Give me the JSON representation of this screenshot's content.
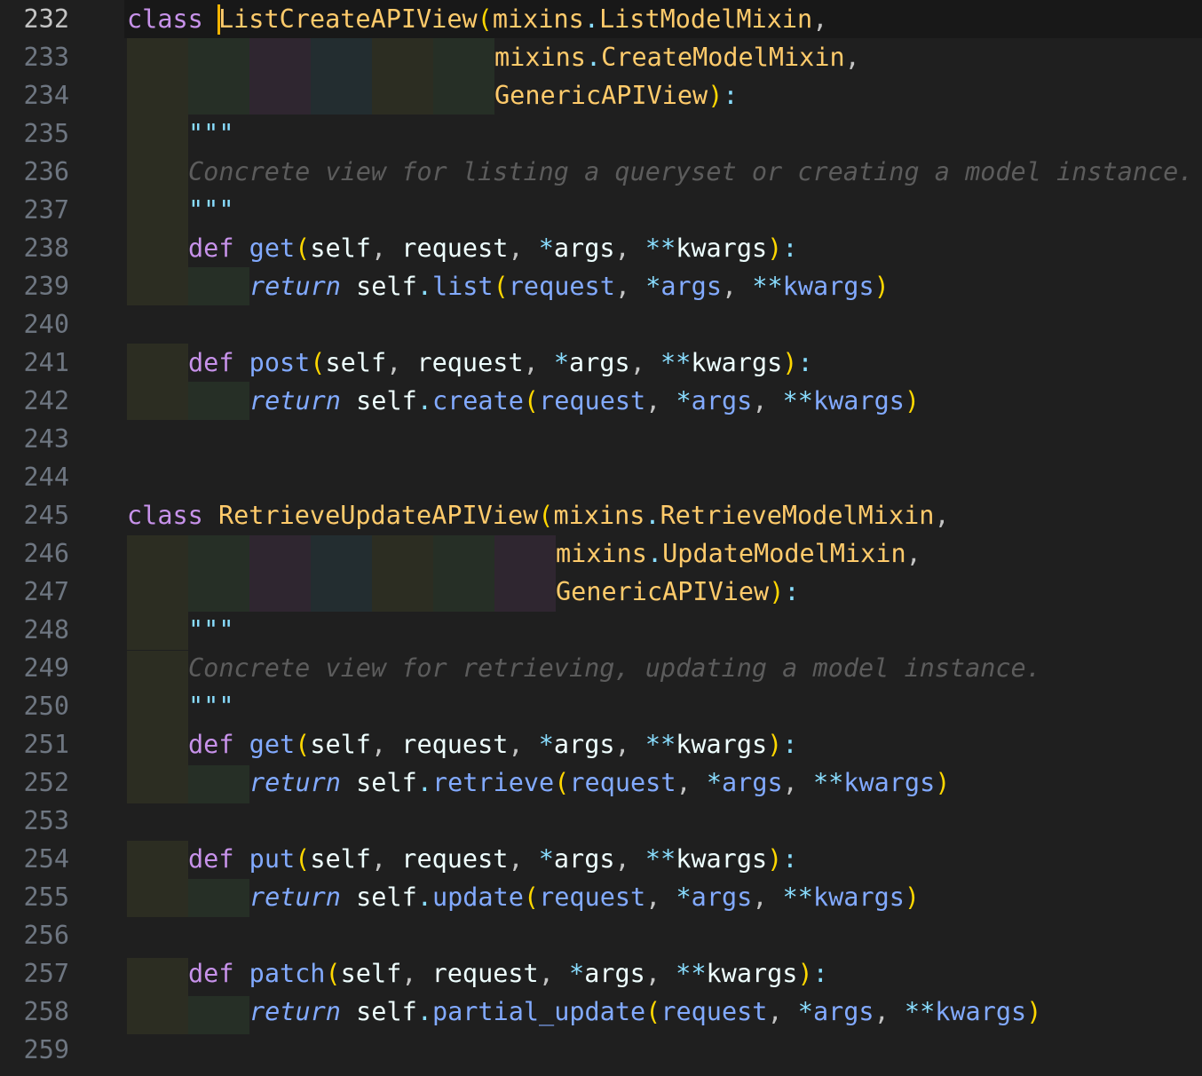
{
  "editor": {
    "current_line": 232,
    "cursor_line": 232
  },
  "line_numbers": [
    "232",
    "233",
    "234",
    "235",
    "236",
    "237",
    "238",
    "239",
    "240",
    "241",
    "242",
    "243",
    "244",
    "245",
    "246",
    "247",
    "248",
    "249",
    "250",
    "251",
    "252",
    "253",
    "254",
    "255",
    "256",
    "257",
    "258",
    "259"
  ],
  "code": {
    "l232": {
      "kw": "class",
      "name": "ListCreateAPIView",
      "open": "(",
      "mod": "mixins",
      "dot": ".",
      "base": "ListModelMixin",
      "comma": ","
    },
    "l233": {
      "mod": "mixins",
      "dot": ".",
      "base": "CreateModelMixin",
      "comma": ","
    },
    "l234": {
      "base": "GenericAPIView",
      "close": ")",
      "colon": ":"
    },
    "l235": {
      "quote": "\"\"\""
    },
    "l236": {
      "doc": "Concrete view for listing a queryset or creating a model instance."
    },
    "l237": {
      "quote": "\"\"\""
    },
    "l238": {
      "kw": "def",
      "fn": "get",
      "self": "self",
      "request": "request",
      "star": "*",
      "args": "args",
      "dstar": "**",
      "kwargs": "kwargs"
    },
    "l239": {
      "ret": "return",
      "self": "self",
      "call": "list",
      "request": "request",
      "star": "*",
      "args": "args",
      "dstar": "**",
      "kwargs": "kwargs"
    },
    "l241": {
      "kw": "def",
      "fn": "post",
      "self": "self",
      "request": "request",
      "star": "*",
      "args": "args",
      "dstar": "**",
      "kwargs": "kwargs"
    },
    "l242": {
      "ret": "return",
      "self": "self",
      "call": "create",
      "request": "request",
      "star": "*",
      "args": "args",
      "dstar": "**",
      "kwargs": "kwargs"
    },
    "l245": {
      "kw": "class",
      "name": "RetrieveUpdateAPIView",
      "open": "(",
      "mod": "mixins",
      "dot": ".",
      "base": "RetrieveModelMixin",
      "comma": ","
    },
    "l246": {
      "mod": "mixins",
      "dot": ".",
      "base": "UpdateModelMixin",
      "comma": ","
    },
    "l247": {
      "base": "GenericAPIView",
      "close": ")",
      "colon": ":"
    },
    "l248": {
      "quote": "\"\"\""
    },
    "l249": {
      "doc": "Concrete view for retrieving, updating a model instance."
    },
    "l250": {
      "quote": "\"\"\""
    },
    "l251": {
      "kw": "def",
      "fn": "get",
      "self": "self",
      "request": "request",
      "star": "*",
      "args": "args",
      "dstar": "**",
      "kwargs": "kwargs"
    },
    "l252": {
      "ret": "return",
      "self": "self",
      "call": "retrieve",
      "request": "request",
      "star": "*",
      "args": "args",
      "dstar": "**",
      "kwargs": "kwargs"
    },
    "l254": {
      "kw": "def",
      "fn": "put",
      "self": "self",
      "request": "request",
      "star": "*",
      "args": "args",
      "dstar": "**",
      "kwargs": "kwargs"
    },
    "l255": {
      "ret": "return",
      "self": "self",
      "call": "update",
      "request": "request",
      "star": "*",
      "args": "args",
      "dstar": "**",
      "kwargs": "kwargs"
    },
    "l257": {
      "kw": "def",
      "fn": "patch",
      "self": "self",
      "request": "request",
      "star": "*",
      "args": "args",
      "dstar": "**",
      "kwargs": "kwargs"
    },
    "l258": {
      "ret": "return",
      "self": "self",
      "call": "partial_update",
      "request": "request",
      "star": "*",
      "args": "args",
      "dstar": "**",
      "kwargs": "kwargs"
    }
  }
}
